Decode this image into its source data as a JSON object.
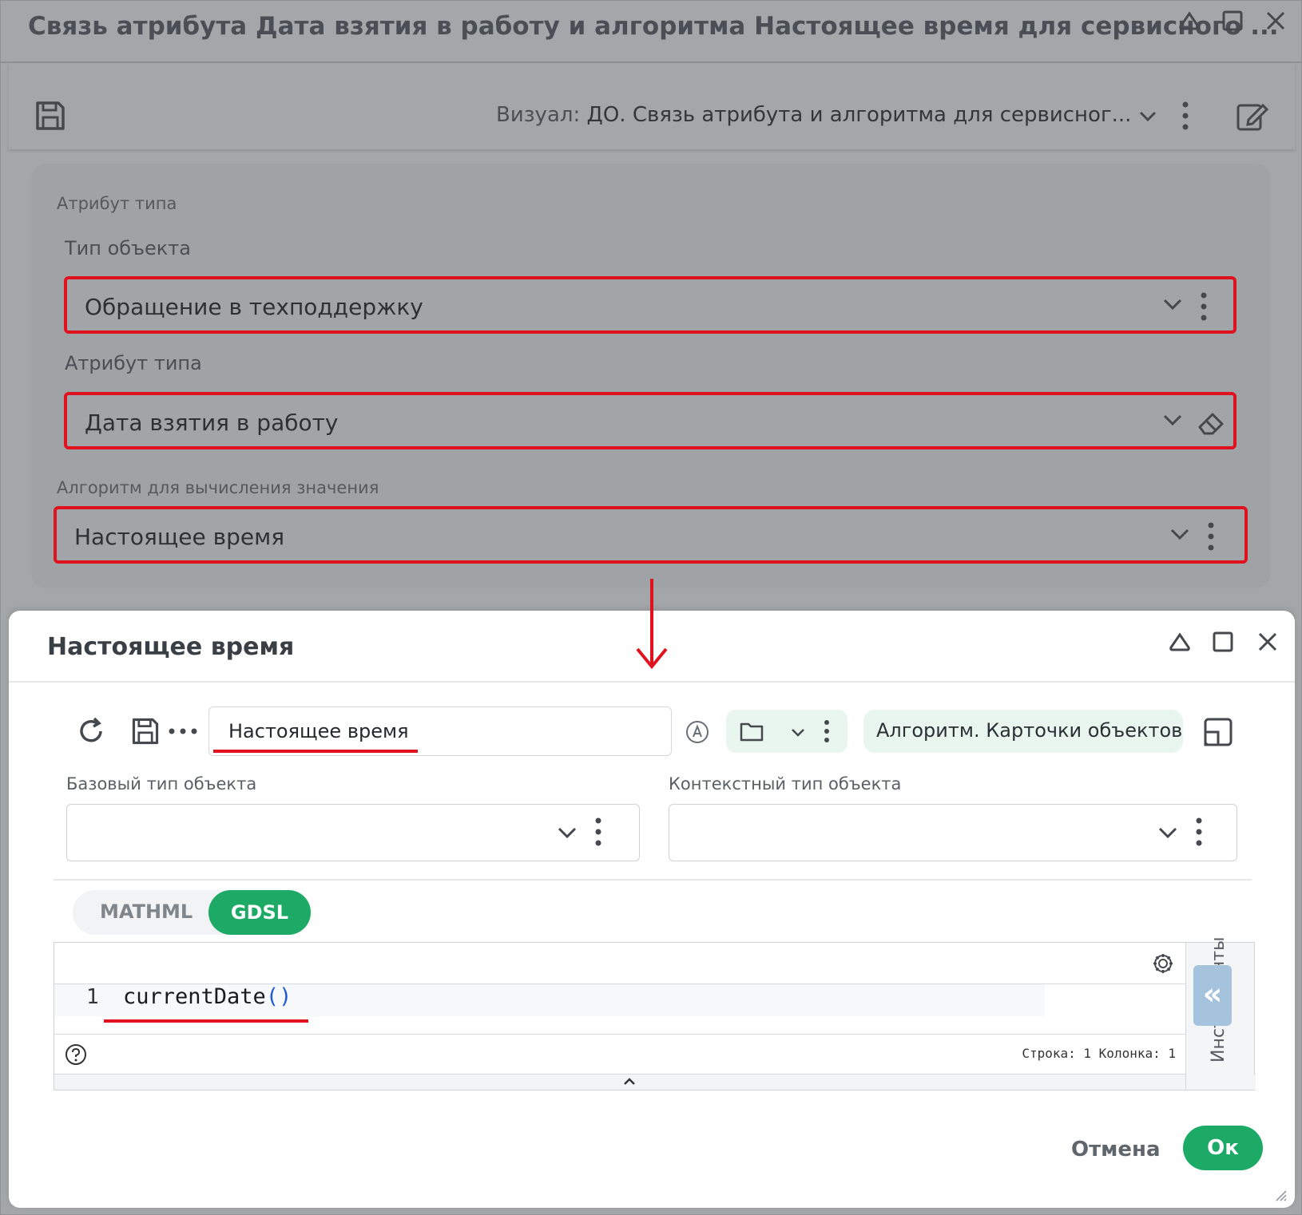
{
  "outer_window": {
    "title": "Связь атрибута Дата взятия в работу и алгоритма Настоящее время для сервисного ...",
    "visual_label": "Визуал:",
    "visual_value": "ДО. Связь атрибута и алгоритма для сервисног...",
    "section_label": "Атрибут типа",
    "object_type_label": "Тип объекта",
    "object_type_value": "Обращение в техподдержку",
    "attribute_label": "Атрибут типа",
    "attribute_value": "Дата взятия в работу",
    "algorithm_label": "Алгоритм для вычисления значения",
    "algorithm_value": "Настоящее время"
  },
  "dialog": {
    "title": "Настоящее время",
    "name_value": "Настоящее время",
    "category_chip": "Алгоритм. Карточки объектов",
    "base_type_label": "Базовый тип объекта",
    "context_type_label": "Контекстный тип объекта",
    "tab_mathml": "MATHML",
    "tab_gdsl": "GDSL",
    "line_number": "1",
    "code_fn": "currentDate",
    "code_parens": "()",
    "status_text": "Строка: 1 Колонка: 1",
    "side_panel": "Инструменты",
    "cancel_label": "Отмена",
    "ok_label": "Ок"
  },
  "colors": {
    "highlight_red": "#e0121f",
    "accent_green": "#1daa67",
    "overlay_gray": "#a4a7aa"
  }
}
